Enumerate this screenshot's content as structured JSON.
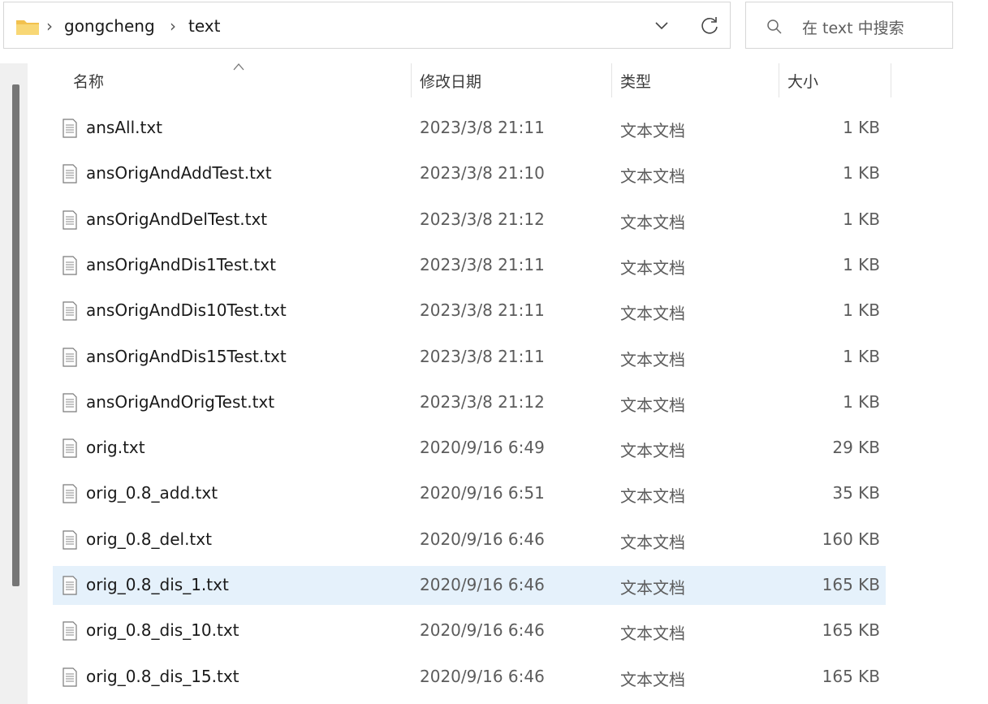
{
  "address": {
    "breadcrumb": [
      "gongcheng",
      "text"
    ],
    "separator": "›",
    "icons": {
      "folder": "folder-icon",
      "dropdown": "chevron-down-icon",
      "refresh": "refresh-icon"
    }
  },
  "search": {
    "placeholder": "在 text 中搜索",
    "icon": "search-icon"
  },
  "columns": {
    "name": "名称",
    "modified": "修改日期",
    "type": "类型",
    "size": "大小"
  },
  "files": [
    {
      "name": "ansAll.txt",
      "modified": "2023/3/8 21:11",
      "type": "文本文档",
      "size": "1 KB"
    },
    {
      "name": "ansOrigAndAddTest.txt",
      "modified": "2023/3/8 21:10",
      "type": "文本文档",
      "size": "1 KB"
    },
    {
      "name": "ansOrigAndDelTest.txt",
      "modified": "2023/3/8 21:12",
      "type": "文本文档",
      "size": "1 KB"
    },
    {
      "name": "ansOrigAndDis1Test.txt",
      "modified": "2023/3/8 21:11",
      "type": "文本文档",
      "size": "1 KB"
    },
    {
      "name": "ansOrigAndDis10Test.txt",
      "modified": "2023/3/8 21:11",
      "type": "文本文档",
      "size": "1 KB"
    },
    {
      "name": "ansOrigAndDis15Test.txt",
      "modified": "2023/3/8 21:11",
      "type": "文本文档",
      "size": "1 KB"
    },
    {
      "name": "ansOrigAndOrigTest.txt",
      "modified": "2023/3/8 21:12",
      "type": "文本文档",
      "size": "1 KB"
    },
    {
      "name": "orig.txt",
      "modified": "2020/9/16 6:49",
      "type": "文本文档",
      "size": "29 KB"
    },
    {
      "name": "orig_0.8_add.txt",
      "modified": "2020/9/16 6:51",
      "type": "文本文档",
      "size": "35 KB"
    },
    {
      "name": "orig_0.8_del.txt",
      "modified": "2020/9/16 6:46",
      "type": "文本文档",
      "size": "160 KB"
    },
    {
      "name": "orig_0.8_dis_1.txt",
      "modified": "2020/9/16 6:46",
      "type": "文本文档",
      "size": "165 KB",
      "selected": true
    },
    {
      "name": "orig_0.8_dis_10.txt",
      "modified": "2020/9/16 6:46",
      "type": "文本文档",
      "size": "165 KB"
    },
    {
      "name": "orig_0.8_dis_15.txt",
      "modified": "2020/9/16 6:46",
      "type": "文本文档",
      "size": "165 KB"
    }
  ],
  "colors": {
    "selected_row": "#e5f1fb",
    "folder": "#f2c14e",
    "scrollbar": "#767676"
  }
}
